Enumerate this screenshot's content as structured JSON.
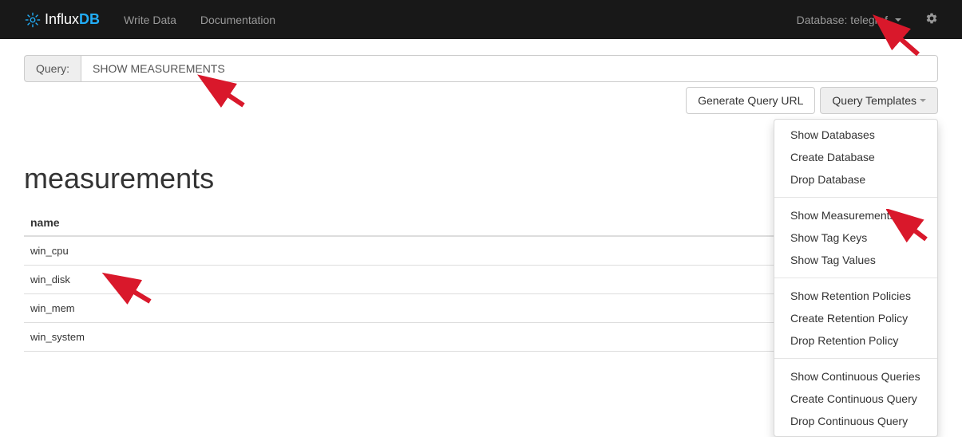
{
  "navbar": {
    "brand_influx": "Influx",
    "brand_db": "DB",
    "links": [
      {
        "label": "Write Data"
      },
      {
        "label": "Documentation"
      }
    ],
    "db_label": "Database: telegraf"
  },
  "query": {
    "label": "Query:",
    "value": "SHOW MEASUREMENTS"
  },
  "buttons": {
    "generate": "Generate Query URL",
    "templates": "Query Templates"
  },
  "dropdown": {
    "groups": [
      [
        "Show Databases",
        "Create Database",
        "Drop Database"
      ],
      [
        "Show Measurements",
        "Show Tag Keys",
        "Show Tag Values"
      ],
      [
        "Show Retention Policies",
        "Create Retention Policy",
        "Drop Retention Policy"
      ],
      [
        "Show Continuous Queries",
        "Create Continuous Query",
        "Drop Continuous Query"
      ]
    ]
  },
  "results": {
    "title": "measurements",
    "column": "name",
    "rows": [
      "win_cpu",
      "win_disk",
      "win_mem",
      "win_system"
    ]
  }
}
